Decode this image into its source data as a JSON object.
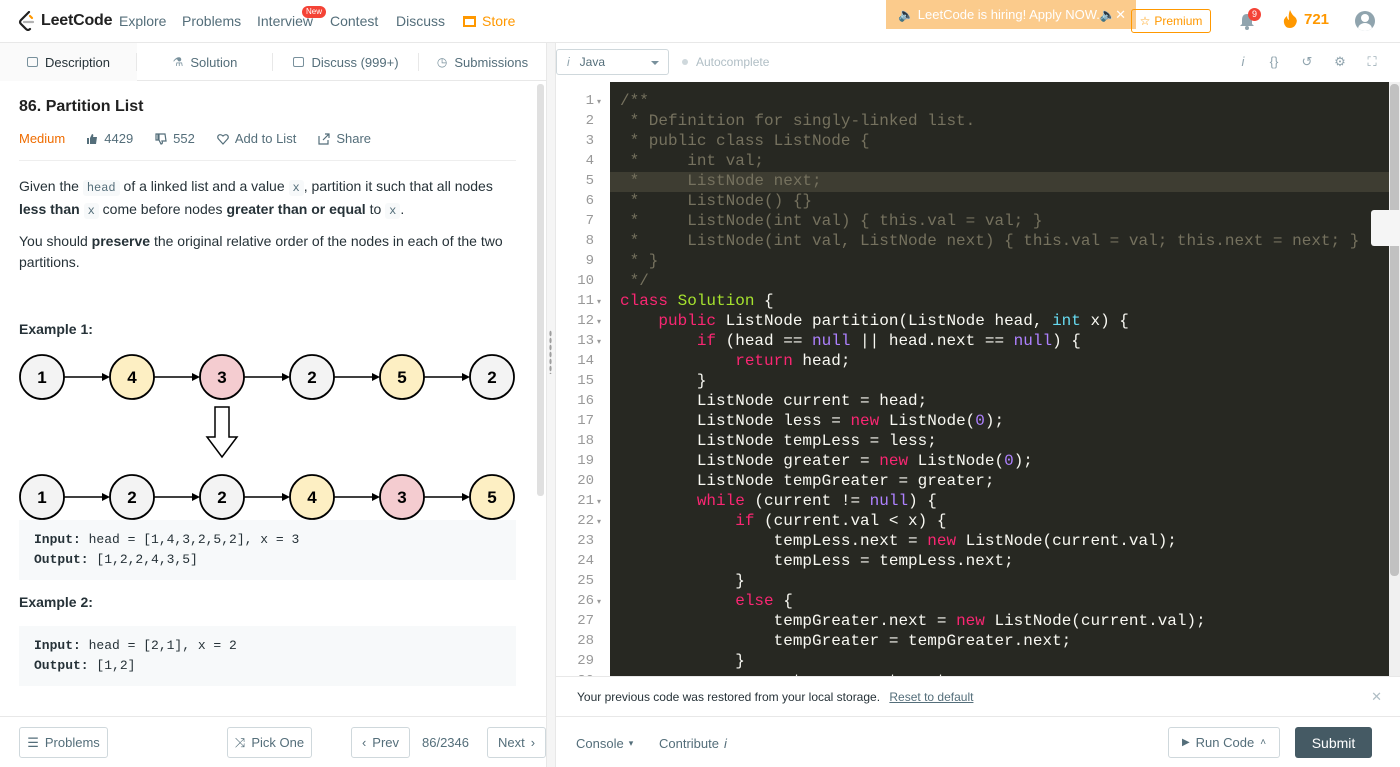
{
  "nav": {
    "logo": "LeetCode",
    "links": [
      "Explore",
      "Problems",
      "Interview",
      "Contest",
      "Discuss",
      "Store"
    ],
    "new_badge": "New",
    "hiring_banner": "🔈 LeetCode is hiring! Apply NOW.🔈",
    "premium": "Premium",
    "notifications": "9",
    "streak": "721"
  },
  "tabs": [
    "Description",
    "Solution",
    "Discuss (999+)",
    "Submissions"
  ],
  "problem": {
    "title": "86. Partition List",
    "difficulty": "Medium",
    "likes": "4429",
    "dislikes": "552",
    "add_to_list": "Add to List",
    "share": "Share",
    "para1_a": "Given the ",
    "para1_head": "head",
    "para1_b": " of a linked list and a value ",
    "para1_x": "x",
    "para1_c": ", partition it such that all nodes ",
    "para1_less": "less than",
    "para1_x2": "x",
    "para1_d": " come before nodes ",
    "para1_greater": "greater than or equal",
    "para1_e": " to ",
    "para1_x3": "x",
    "para1_f": ".",
    "para2_a": "You should ",
    "para2_bold": "preserve",
    "para2_b": " the original relative order of the nodes in each of the two partitions.",
    "example1_title": "Example 1:",
    "example1_input_label": "Input:",
    "example1_input": " head = [1,4,3,2,5,2], x = 3",
    "example1_output_label": "Output:",
    "example1_output": " [1,2,2,4,3,5]",
    "example2_title": "Example 2:",
    "example2_input_label": "Input:",
    "example2_input": " head = [2,1], x = 2",
    "example2_output_label": "Output:",
    "example2_output": " [1,2]"
  },
  "diagram": {
    "top_row": [
      "1",
      "4",
      "3",
      "2",
      "5",
      "2"
    ],
    "bottom_row": [
      "1",
      "2",
      "2",
      "4",
      "3",
      "5"
    ],
    "colors": {
      "white": "#f3f3f3",
      "yellow": "#fdefc3",
      "red": "#f4ccd0"
    }
  },
  "footer_left": {
    "problems": "Problems",
    "pick_one": "Pick One",
    "prev": "Prev",
    "pager": "86/2346",
    "next": "Next"
  },
  "editor": {
    "language": "Java",
    "autocomplete": "Autocomplete",
    "restore_msg": "Your previous code was restored from your local storage.",
    "reset_link": "Reset to default"
  },
  "footer_right": {
    "console": "Console",
    "contribute": "Contribute",
    "run_code": "Run Code",
    "submit": "Submit"
  }
}
